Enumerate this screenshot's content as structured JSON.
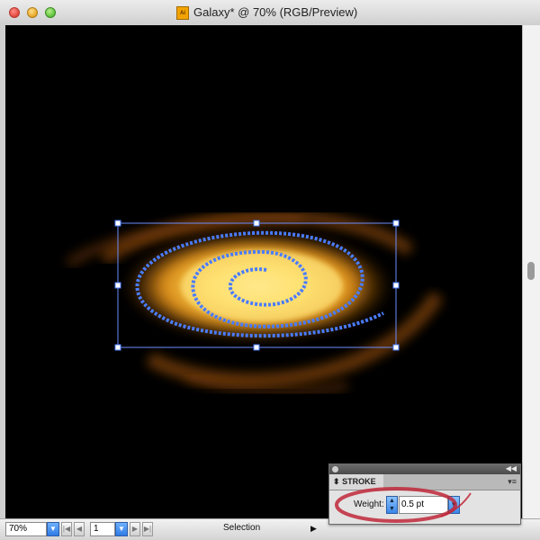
{
  "window": {
    "title": "Galaxy* @ 70% (RGB/Preview)",
    "doc_icon": "Ai"
  },
  "statusbar": {
    "zoom": "70%",
    "page": "1",
    "tool": "Selection"
  },
  "stroke_panel": {
    "tab": "STROKE",
    "weight_label": "Weight:",
    "weight_value": "0.5 pt"
  },
  "colors": {
    "canvas": "#000000",
    "selection": "#4a7cff",
    "galaxy_core": "#ffe27a",
    "galaxy_arm": "#c06a10",
    "annotation": "#c0283a"
  }
}
